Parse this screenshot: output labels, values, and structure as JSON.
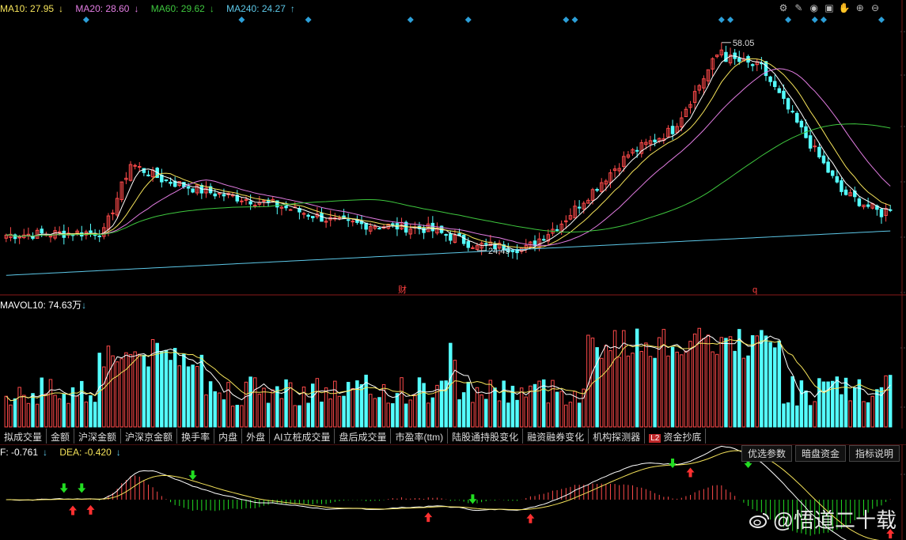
{
  "ma_legend": [
    {
      "label": "MA10: 27.95",
      "arrow": "↓",
      "color": "#f5e35a"
    },
    {
      "label": "MA20: 28.60",
      "arrow": "↓",
      "color": "#e37de3"
    },
    {
      "label": "MA60: 29.62",
      "arrow": "↓",
      "color": "#3ec73e"
    },
    {
      "label": "MA240: 24.27",
      "arrow": "↑",
      "color": "#5dc8e8"
    }
  ],
  "vol_legend": {
    "label": "MAVOL10: 74.63万",
    "arrow": "↓"
  },
  "macd_legend": [
    {
      "label": "F: -0.761",
      "arrow": "↓",
      "color": "#ffffff"
    },
    {
      "label": "DEA: -0.420",
      "arrow": "↓",
      "color": "#f5e35a"
    }
  ],
  "toolbar_icons": [
    "gear-icon",
    "pen-icon",
    "eye-icon",
    "briefcase-icon",
    "hand-icon",
    "zoom-in-icon",
    "zoom-out-icon"
  ],
  "toolbar_glyphs": [
    "⚙",
    "✎",
    "◉",
    "▣",
    "✋",
    "⊕",
    "⊖"
  ],
  "tabs": [
    "拟成交量",
    "金额",
    "沪深金额",
    "沪深京金额",
    "换手率",
    "内盘",
    "外盘",
    "AI立桩成交量",
    "盘后成交量",
    "市盈率(ttm)",
    "陆股通持股变化",
    "融资融券变化",
    "机构探测器",
    "资金抄底"
  ],
  "l2_badge": "L2",
  "right_buttons": [
    "优选参数",
    "暗盘资金",
    "指标说明"
  ],
  "watermark": "@悟道二十载",
  "markers": {
    "cai": "财",
    "q": "q",
    "high": "58.05",
    "low": "24.49"
  },
  "colors": {
    "up": "#ff4a4a",
    "down": "#54ffff",
    "macd_up_arrow": "#ff3030",
    "macd_down_arrow": "#22dd22",
    "signal_diamond": "#2c9fd8"
  },
  "chart_data": {
    "type": "candlestick",
    "n_bars": 200,
    "price_range": [
      19,
      63
    ],
    "key_points": [
      {
        "bar": 0,
        "close": 27.0
      },
      {
        "bar": 22,
        "close": 27.5
      },
      {
        "bar": 28,
        "close": 38.5
      },
      {
        "bar": 35,
        "close": 36.0
      },
      {
        "bar": 45,
        "close": 34.0
      },
      {
        "bar": 60,
        "close": 32.0
      },
      {
        "bar": 75,
        "close": 29.0
      },
      {
        "bar": 95,
        "close": 28.0
      },
      {
        "bar": 105,
        "close": 25.5
      },
      {
        "bar": 117,
        "close": 24.8
      },
      {
        "bar": 125,
        "close": 29.0
      },
      {
        "bar": 140,
        "close": 40.0
      },
      {
        "bar": 150,
        "close": 44.0
      },
      {
        "bar": 160,
        "close": 56.0
      },
      {
        "bar": 170,
        "close": 54.0
      },
      {
        "bar": 178,
        "close": 45.0
      },
      {
        "bar": 188,
        "close": 34.0
      },
      {
        "bar": 197,
        "close": 30.5
      },
      {
        "bar": 200,
        "close": 32.0
      }
    ],
    "high": {
      "bar": 161,
      "value": 58.05
    },
    "low": {
      "bar": 106,
      "value": 24.49
    },
    "volume_range": [
      0,
      220
    ],
    "macd_range": [
      -4,
      4
    ],
    "signal_diamond_bars": [
      18,
      53,
      68,
      91,
      104,
      126,
      128,
      161,
      163,
      176,
      182,
      184,
      197
    ],
    "macd_up_arrow_bars": [
      15,
      19,
      95,
      118,
      154,
      199
    ],
    "macd_down_arrow_bars": [
      13,
      17,
      42,
      105,
      150,
      167
    ]
  }
}
